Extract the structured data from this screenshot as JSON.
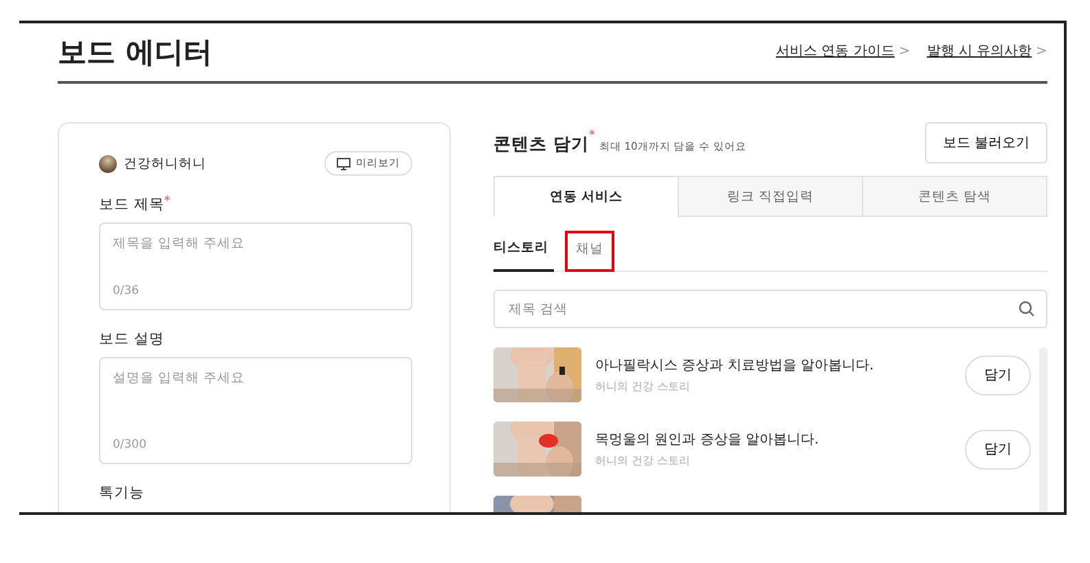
{
  "page_title": "보드 에디터",
  "header_links": [
    {
      "label": "서비스 연동 가이드",
      "arrow": ">"
    },
    {
      "label": "발행 시 유의사항",
      "arrow": ">"
    }
  ],
  "editor": {
    "user_name": "건강허니허니",
    "preview_button": "미리보기",
    "fields": [
      {
        "label": "보드 제목",
        "required_mark": "*",
        "placeholder": "제목을 입력해 주세요",
        "counter": "0/36"
      },
      {
        "label": "보드 설명",
        "placeholder": "설명을 입력해 주세요",
        "counter": "0/300"
      }
    ],
    "next_section": "톡기능"
  },
  "content": {
    "title": "콘텐츠 담기",
    "required_mark": "*",
    "hint": "최대 10개까지 담을 수 있어요",
    "load_button": "보드 불러오기",
    "tabs": [
      {
        "label": "연동 서비스",
        "selected": true
      },
      {
        "label": "링크 직접입력",
        "selected": false
      },
      {
        "label": "콘텐츠 탐색",
        "selected": false
      }
    ],
    "subtabs": [
      {
        "label": "티스토리",
        "selected": true,
        "highlighted": false
      },
      {
        "label": "채널",
        "selected": false,
        "highlighted": true
      }
    ],
    "search": {
      "placeholder": "제목 검색"
    },
    "items": [
      {
        "kind": "picture",
        "title": "아나필락시스 증상과 치료방법을 알아봅니다.",
        "source": "허니의 건강 스토리",
        "button": "담기"
      },
      {
        "kind": "picture",
        "title": "목멍울의 원인과 증상을 알아봅니다.",
        "source": "허니의 건강 스토리",
        "button": "담기"
      },
      {
        "kind": "picture"
      }
    ]
  }
}
